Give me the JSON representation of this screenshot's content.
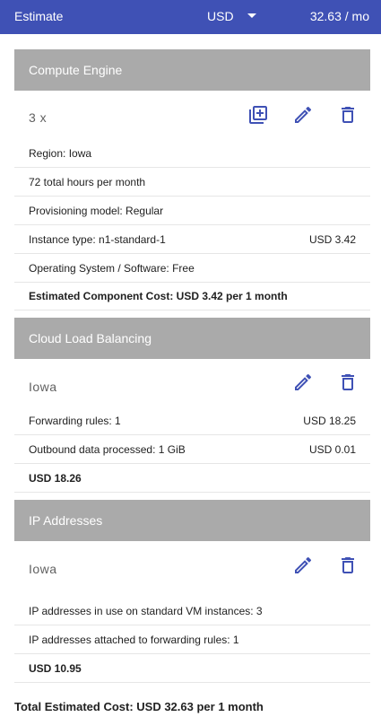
{
  "header": {
    "title": "Estimate",
    "currency": "USD",
    "total": "32.63 / mo"
  },
  "compute": {
    "title": "Compute Engine",
    "item_label": "3 x",
    "rows": {
      "region": "Region: Iowa",
      "hours": "72 total hours per month",
      "provisioning": "Provisioning model: Regular",
      "instance_label": "Instance type: n1-standard-1",
      "instance_value": "USD 3.42",
      "os": "Operating System / Software: Free",
      "cost": "Estimated Component Cost: USD 3.42 per 1 month"
    }
  },
  "load_balancing": {
    "title": "Cloud Load Balancing",
    "item_label": "Iowa",
    "rows": {
      "forwarding_label": "Forwarding rules: 1",
      "forwarding_value": "USD 18.25",
      "outbound_label": "Outbound data processed: 1 GiB",
      "outbound_value": "USD 0.01",
      "cost": "USD 18.26"
    }
  },
  "ip": {
    "title": "IP Addresses",
    "item_label": "Iowa",
    "rows": {
      "standard_vm": "IP addresses in use on standard VM instances: 3",
      "forwarding": "IP addresses attached to forwarding rules: 1",
      "cost": "USD 10.95"
    }
  },
  "footer": {
    "total": "Total Estimated Cost: USD 32.63 per 1 month"
  },
  "icons": {
    "add": "add-to-estimate-icon",
    "edit": "edit-icon",
    "delete": "delete-icon"
  },
  "colors": {
    "header_bar": "#3f51b5",
    "section_header": "#aaaaaa",
    "icon": "#3f51b5"
  }
}
